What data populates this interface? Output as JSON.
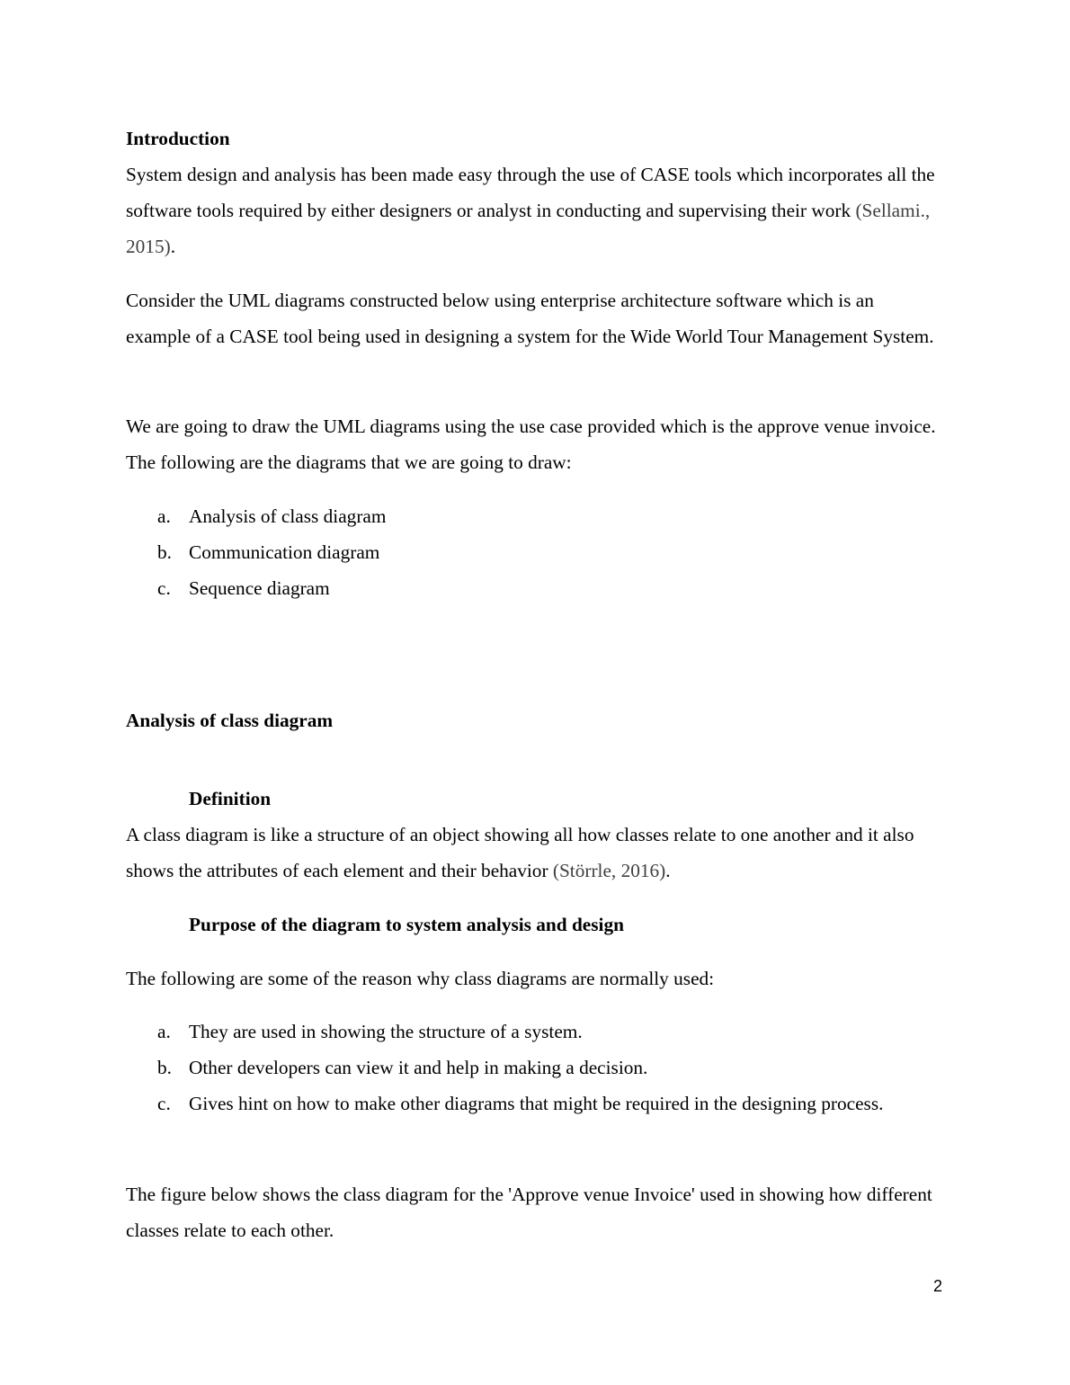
{
  "intro": {
    "heading": "Introduction",
    "p1_text": "System design and analysis has been made easy through the use of CASE tools which incorporates all the software tools required by either designers or analyst in conducting and supervising their work ",
    "p1_cite": "(Sellami., 2015)",
    "p1_end": ".",
    "p2": "Consider the UML diagrams constructed below using enterprise architecture software which is an example of a CASE tool being used in designing a system for the Wide World Tour Management System.",
    "p3": "We are going to draw the UML diagrams using the use case provided which is the approve venue invoice. The following are the diagrams that we are going to draw:",
    "list": [
      {
        "marker": "a.",
        "text": "Analysis of class diagram"
      },
      {
        "marker": "b.",
        "text": "Communication diagram"
      },
      {
        "marker": "c.",
        "text": "Sequence diagram"
      }
    ]
  },
  "class_section": {
    "heading": "Analysis of class diagram",
    "definition_heading": "Definition",
    "definition_text": "A class diagram is like a structure of an object showing all how classes relate to one another and it also shows the attributes of each element and their behavior ",
    "definition_cite": "(Störrle, 2016)",
    "definition_end": ".",
    "purpose_heading": "Purpose of the diagram to system analysis and design",
    "purpose_intro": "The following are some of the reason why class diagrams are normally used:",
    "purpose_list": [
      {
        "marker": "a.",
        "text": "They are used in showing the structure of a system."
      },
      {
        "marker": "b.",
        "text": "Other developers can view it and help in making a decision."
      },
      {
        "marker": "c.",
        "text": "Gives hint on how to make other diagrams that might be required in the designing process."
      }
    ],
    "figure_intro": "The figure below shows the class diagram for the 'Approve venue Invoice' used in showing how different classes relate to each other."
  },
  "footer": {
    "page_number": "2"
  }
}
